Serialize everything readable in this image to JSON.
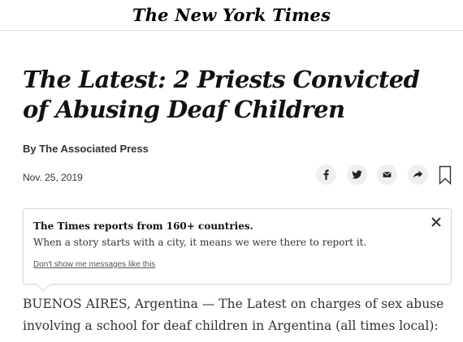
{
  "masthead": {
    "logo": "The New York Times"
  },
  "article": {
    "headline": "The Latest: 2 Priests Convicted of Abusing Deaf Children",
    "byline": "By The Associated Press",
    "date": "Nov. 25, 2019",
    "lede": "BUENOS AIRES, Argentina — The Latest on charges of sex abuse involving a school for deaf children in Argentina (all times local):"
  },
  "share": {
    "icons": [
      "facebook-icon",
      "twitter-icon",
      "email-icon",
      "share-icon",
      "bookmark-icon"
    ]
  },
  "notice": {
    "title": "The Times reports from 160+ countries.",
    "body": "When a story starts with a city, it means we were there to report it.",
    "dismiss_link": "Don't show me messages like this"
  },
  "colors": {
    "text": "#121212",
    "secondary": "#333333",
    "button_bg": "#efefef",
    "rule": "#e2e2e2"
  }
}
